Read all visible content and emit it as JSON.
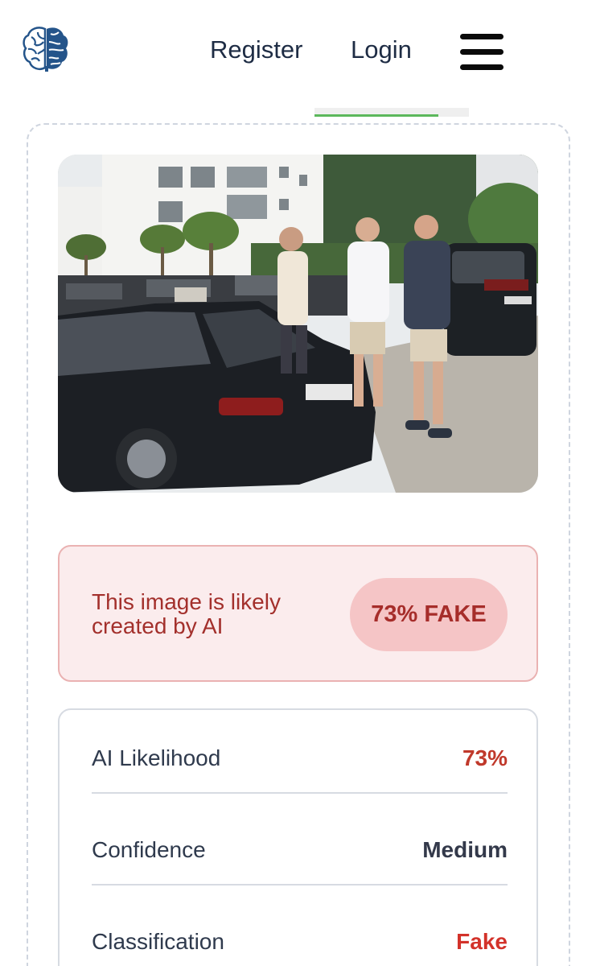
{
  "nav": {
    "register_label": "Register",
    "login_label": "Login",
    "menu_icon": "hamburger-menu-icon",
    "logo_icon": "brain-logo-icon"
  },
  "page_progress": 0.8,
  "image": {
    "description_icon": "uploaded-photo"
  },
  "result": {
    "message": "This image is likely created by AI",
    "verdict_badge": "73% FAKE"
  },
  "details": [
    {
      "label": "AI Likelihood",
      "value": "73%"
    },
    {
      "label": "Confidence",
      "value": "Medium"
    },
    {
      "label": "Classification",
      "value": "Fake"
    }
  ],
  "colors": {
    "brand_blue": "#24548a",
    "danger": "#c0392b",
    "danger_bg": "#fbeced",
    "pill_bg": "#f5c5c6",
    "accent_green": "#5cb85c",
    "text_dark": "#1e2c44"
  }
}
